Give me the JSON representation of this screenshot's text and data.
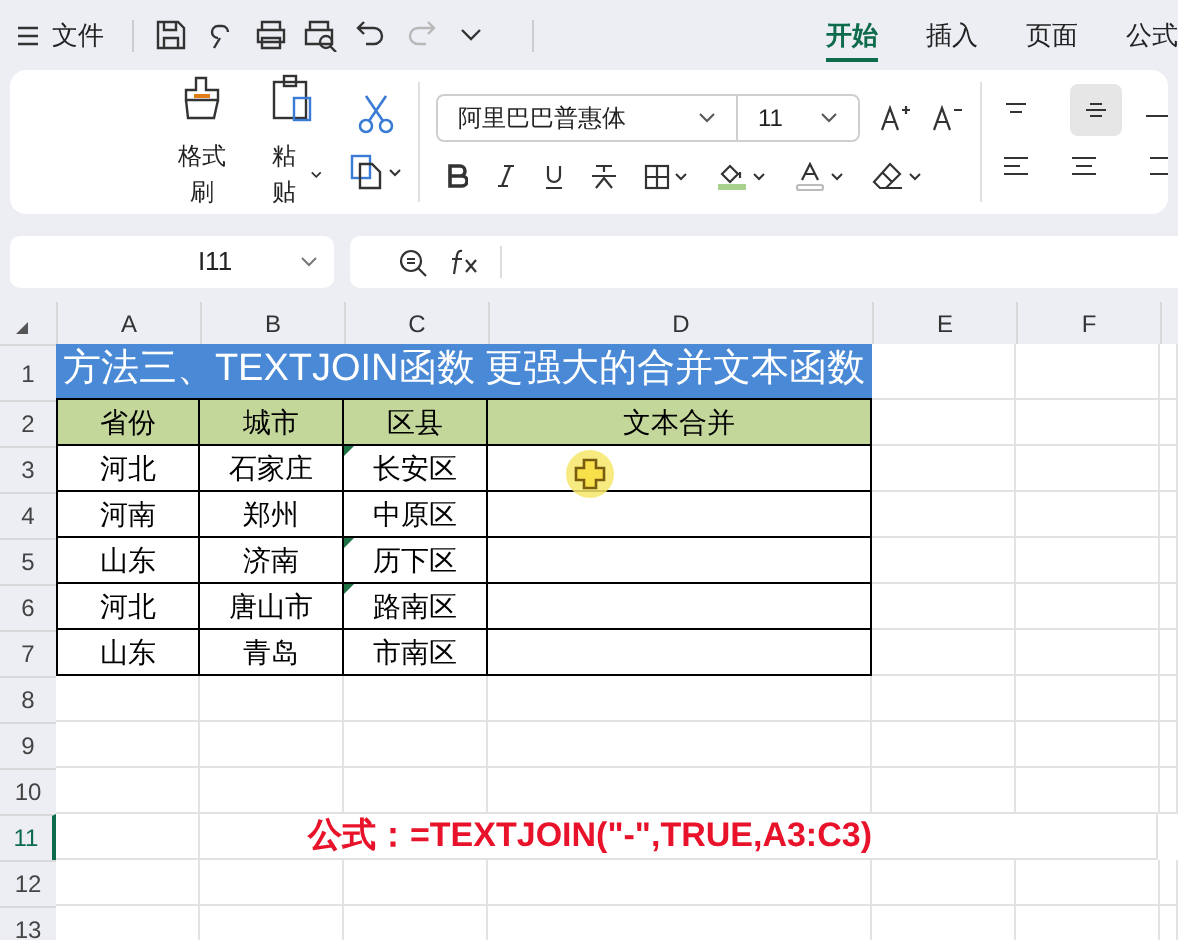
{
  "menu": {
    "file": "文件"
  },
  "quick_tools": [
    {
      "kind": "save",
      "disabled": false
    },
    {
      "kind": "link",
      "disabled": false
    },
    {
      "kind": "print",
      "disabled": false
    },
    {
      "kind": "preview",
      "disabled": false
    },
    {
      "kind": "undo",
      "disabled": false
    },
    {
      "kind": "redo",
      "disabled": true
    },
    {
      "kind": "more",
      "disabled": false
    }
  ],
  "tabs": [
    {
      "label": "开始",
      "selected": true
    },
    {
      "label": "插入",
      "selected": false
    },
    {
      "label": "页面",
      "selected": false
    },
    {
      "label": "公式",
      "selected": false
    }
  ],
  "ribbon": {
    "format_painter": "格式刷",
    "paste": "粘贴",
    "font": "阿里巴巴普惠体",
    "size": "11"
  },
  "name_box": "I11",
  "columns": [
    "A",
    "B",
    "C",
    "D",
    "E",
    "F"
  ],
  "rows": [
    {
      "header": "1",
      "kind": "title",
      "selected": false,
      "text": "方法三、TEXTJOIN函数 更强大的合并文本函数"
    },
    {
      "header": "2",
      "kind": "head",
      "selected": false,
      "cells": [
        {
          "text": "省份",
          "flag": false
        },
        {
          "text": "城市",
          "flag": false
        },
        {
          "text": "区县",
          "flag": false
        },
        {
          "text": "文本合并",
          "flag": false
        }
      ]
    },
    {
      "header": "3",
      "kind": "data",
      "selected": false,
      "cells": [
        {
          "text": "河北",
          "flag": false
        },
        {
          "text": "石家庄",
          "flag": false
        },
        {
          "text": "长安区",
          "flag": true
        }
      ]
    },
    {
      "header": "4",
      "kind": "data",
      "selected": false,
      "cells": [
        {
          "text": "河南",
          "flag": false
        },
        {
          "text": "郑州",
          "flag": false
        },
        {
          "text": "中原区",
          "flag": false
        }
      ]
    },
    {
      "header": "5",
      "kind": "data",
      "selected": false,
      "cells": [
        {
          "text": "山东",
          "flag": false
        },
        {
          "text": "济南",
          "flag": false
        },
        {
          "text": "历下区",
          "flag": true
        }
      ]
    },
    {
      "header": "6",
      "kind": "data",
      "selected": false,
      "cells": [
        {
          "text": "河北",
          "flag": false
        },
        {
          "text": "唐山市",
          "flag": false
        },
        {
          "text": "路南区",
          "flag": true
        }
      ]
    },
    {
      "header": "7",
      "kind": "data",
      "selected": false,
      "cells": [
        {
          "text": "山东",
          "flag": false
        },
        {
          "text": "青岛",
          "flag": false
        },
        {
          "text": "市南区",
          "flag": false
        }
      ]
    },
    {
      "header": "8",
      "kind": "empty",
      "selected": false
    },
    {
      "header": "9",
      "kind": "empty",
      "selected": false
    },
    {
      "header": "10",
      "kind": "empty",
      "selected": false
    },
    {
      "header": "11",
      "kind": "note",
      "selected": true,
      "text": "公式：=TEXTJOIN(\"-\",TRUE,A3:C3)"
    },
    {
      "header": "12",
      "kind": "empty",
      "selected": false
    },
    {
      "header": "13",
      "kind": "empty",
      "selected": false
    }
  ]
}
